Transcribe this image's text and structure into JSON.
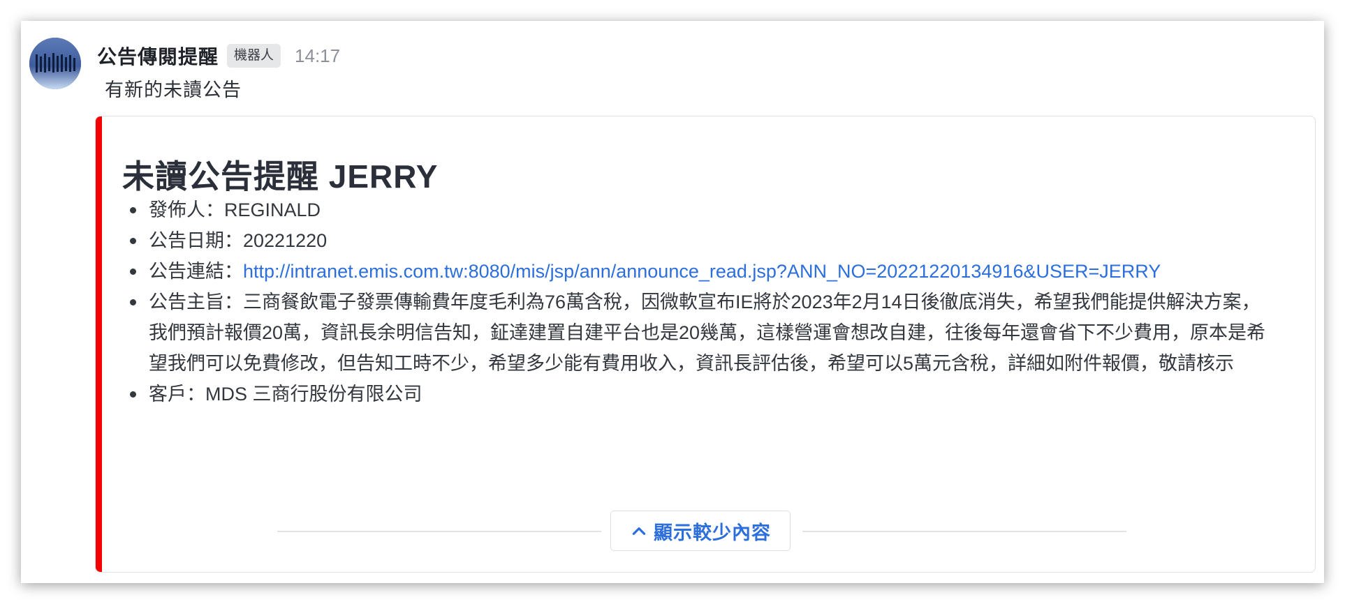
{
  "message": {
    "sender": "公告傳閱提醒",
    "badge": "機器人",
    "time": "14:17",
    "text": "有新的未讀公告",
    "avatar_icon": "organization-logo-icon"
  },
  "card": {
    "accent_color": "#f40000",
    "title": "未讀公告提醒 JERRY",
    "items": [
      {
        "label": "發佈人：",
        "value": "REGINALD"
      },
      {
        "label": "公告日期：",
        "value": "20221220"
      },
      {
        "label": "公告連結：",
        "value": "http://intranet.emis.com.tw:8080/mis/jsp/ann/announce_read.jsp?ANN_NO=20221220134916&USER=JERRY"
      },
      {
        "label": "公告主旨：",
        "value": "三商餐飲電子發票傳輸費年度毛利為76萬含稅，因微軟宣布IE將於2023年2月14日後徹底消失，希望我們能提供解決方案，我們預計報價20萬，資訊長余明信告知，鉦達建置自建平台也是20幾萬，這樣營運會想改自建，往後每年還會省下不少費用，原本是希望我們可以免費修改，但告知工時不少，希望多少能有費用收入，資訊長評估後，希望可以5萬元含稅，詳細如附件報價，敬請核示"
      },
      {
        "label": "客戶：",
        "value": "MDS 三商行股份有限公司"
      }
    ],
    "toggle_label": "顯示較少內容",
    "toggle_icon": "chevron-up-icon",
    "link_color": "#2c6fdc"
  }
}
